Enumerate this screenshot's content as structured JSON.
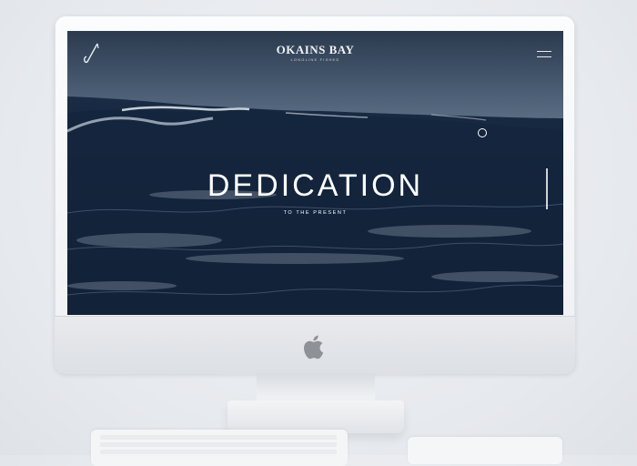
{
  "site": {
    "brand_title": "OKAINS BAY",
    "brand_subtitle": "LONGLINE FISHED",
    "headline": "DEDICATION",
    "subheadline": "TO THE PRESENT"
  },
  "icons": {
    "site_logo": "hook-logo-icon",
    "menu": "hamburger-menu-icon",
    "device_logo": "apple-logo-icon"
  },
  "colors": {
    "sky": "#3b4d63",
    "sea_dark": "#0b1a2e",
    "text": "#ffffff"
  }
}
